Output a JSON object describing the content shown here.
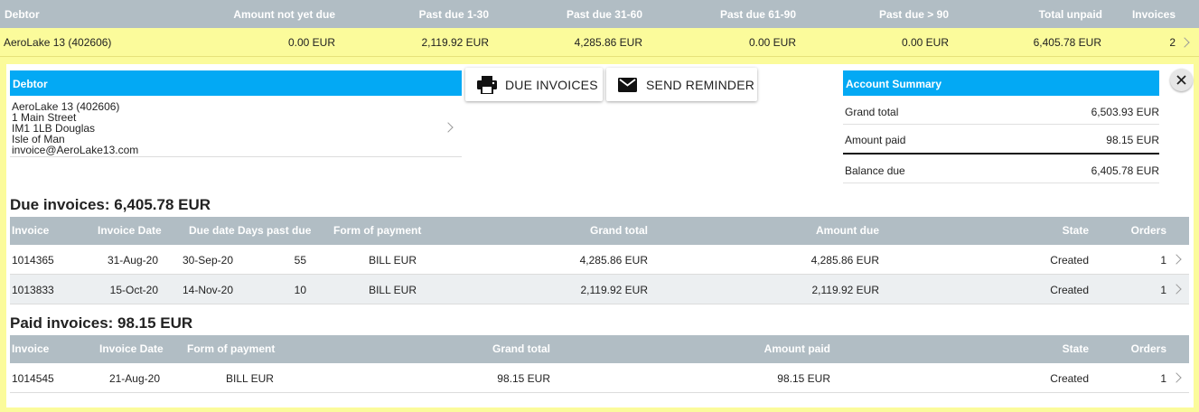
{
  "aging": {
    "headers": {
      "debtor": "Debtor",
      "not_due": "Amount not yet due",
      "due_1_30": "Past due 1-30",
      "due_31_60": "Past due 31-60",
      "due_61_90": "Past due 61-90",
      "due_90": "Past due > 90",
      "total_unpaid": "Total unpaid",
      "invoices": "Invoices"
    },
    "row": {
      "debtor": "AeroLake 13 (402606)",
      "not_due": "0.00 EUR",
      "due_1_30": "2,119.92 EUR",
      "due_31_60": "4,285.86 EUR",
      "due_61_90": "0.00 EUR",
      "due_90": "0.00 EUR",
      "total_unpaid": "6,405.78 EUR",
      "invoices": "2"
    }
  },
  "debtor_card": {
    "title": "Debtor",
    "lines": [
      "AeroLake 13 (402606)",
      "1 Main Street",
      "IM1 1LB Douglas",
      "Isle of Man",
      "invoice@AeroLake13.com"
    ]
  },
  "actions": {
    "due_invoices": "DUE INVOICES",
    "send_reminder": "SEND REMINDER"
  },
  "account_summary": {
    "title": "Account Summary",
    "grand_total_label": "Grand total",
    "grand_total": "6,503.93 EUR",
    "amount_paid_label": "Amount paid",
    "amount_paid": "98.15 EUR",
    "balance_due_label": "Balance due",
    "balance_due": "6,405.78 EUR"
  },
  "due_invoices": {
    "title": "Due invoices: 6,405.78 EUR",
    "headers": {
      "invoice": "Invoice",
      "invoice_date": "Invoice Date",
      "due_date": "Due date",
      "days_past_due": "Days past due",
      "form_of_payment": "Form of payment",
      "grand_total": "Grand total",
      "amount_due": "Amount due",
      "state": "State",
      "orders": "Orders"
    },
    "rows": [
      {
        "invoice": "1014365",
        "invoice_date": "31-Aug-20",
        "due_date": "30-Sep-20",
        "days_past_due": "55",
        "form_of_payment": "BILL EUR",
        "grand_total": "4,285.86 EUR",
        "amount_due": "4,285.86 EUR",
        "state": "Created",
        "orders": "1"
      },
      {
        "invoice": "1013833",
        "invoice_date": "15-Oct-20",
        "due_date": "14-Nov-20",
        "days_past_due": "10",
        "form_of_payment": "BILL EUR",
        "grand_total": "2,119.92 EUR",
        "amount_due": "2,119.92 EUR",
        "state": "Created",
        "orders": "1"
      }
    ]
  },
  "paid_invoices": {
    "title": "Paid invoices: 98.15 EUR",
    "headers": {
      "invoice": "Invoice",
      "invoice_date": "Invoice Date",
      "form_of_payment": "Form of payment",
      "grand_total": "Grand total",
      "amount_paid": "Amount paid",
      "state": "State",
      "orders": "Orders"
    },
    "rows": [
      {
        "invoice": "1014545",
        "invoice_date": "21-Aug-20",
        "form_of_payment": "BILL EUR",
        "grand_total": "98.15 EUR",
        "amount_paid": "98.15 EUR",
        "state": "Created",
        "orders": "1"
      }
    ]
  },
  "icons": {
    "print": "printer-icon",
    "mail": "envelope-icon",
    "close": "close-icon",
    "chevron": "chevron-right-icon"
  },
  "colors": {
    "header_gray": "#b1bdc4",
    "highlight_yellow": "#fbfb9b",
    "accent_blue": "#03a9f4",
    "alt_row": "#eceff1"
  }
}
